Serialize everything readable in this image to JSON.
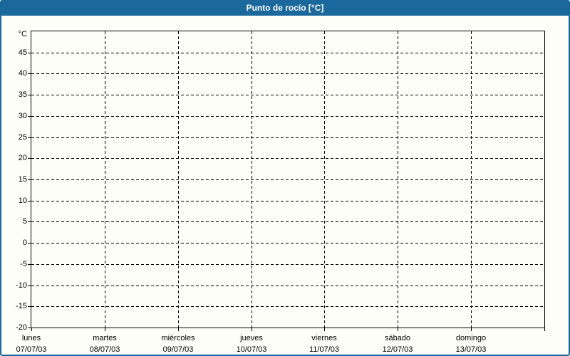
{
  "header": {
    "title": "Punto de rocío [°C]"
  },
  "colors": {
    "header_bg": "#1A689C",
    "header_text": "#FFFFFF",
    "frame_border": "#1A689C",
    "background": "#FDFEF8",
    "plot_border": "#000000",
    "grid": "#000000",
    "label_text": "#000000"
  },
  "chart_data": {
    "type": "line",
    "title": "Punto de rocío [°C]",
    "ylabel": "°C",
    "ylim": [
      -20,
      50
    ],
    "ytick_step": 5,
    "yticks": [
      45,
      40,
      35,
      30,
      25,
      20,
      15,
      10,
      5,
      0,
      -5,
      -10,
      -15,
      -20
    ],
    "x_days": [
      {
        "weekday": "lunes",
        "date": "07/07/03"
      },
      {
        "weekday": "martes",
        "date": "08/07/03"
      },
      {
        "weekday": "miércoles",
        "date": "09/07/03"
      },
      {
        "weekday": "jueves",
        "date": "10/07/03"
      },
      {
        "weekday": "viernes",
        "date": "11/07/03"
      },
      {
        "weekday": "sábado",
        "date": "12/07/03"
      },
      {
        "weekday": "domingo",
        "date": "13/07/03"
      }
    ],
    "series": [],
    "grid": "dashed",
    "legend_position": "none"
  }
}
